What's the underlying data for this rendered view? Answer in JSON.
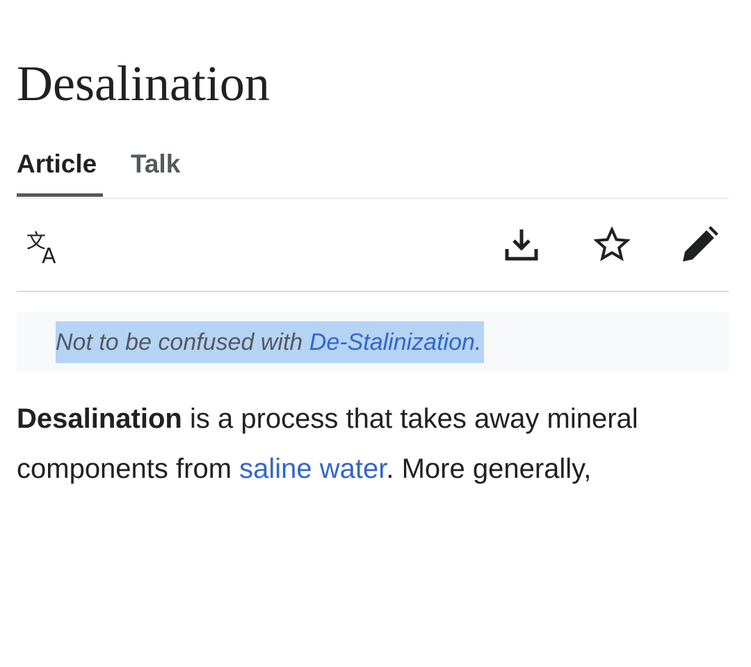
{
  "page": {
    "title": "Desalination"
  },
  "tabs": [
    {
      "label": "Article",
      "active": true
    },
    {
      "label": "Talk",
      "active": false
    }
  ],
  "toolbar": {
    "language_icon": "language-icon",
    "download_icon": "download-icon",
    "watch_icon": "star-icon",
    "edit_icon": "pencil-icon"
  },
  "hatnote": {
    "prefix": "Not to be confused with ",
    "link": "De-Stalinization",
    "suffix": "."
  },
  "lead": {
    "term": "Desalination",
    "text1": " is a process that takes away mineral components from ",
    "link": "saline water",
    "text2": ". More generally,"
  },
  "colors": {
    "link": "#3366cc",
    "text": "#202122",
    "muted": "#54595d",
    "selection": "#b5d3f5",
    "hatnote_bg": "#f8f9fa"
  }
}
